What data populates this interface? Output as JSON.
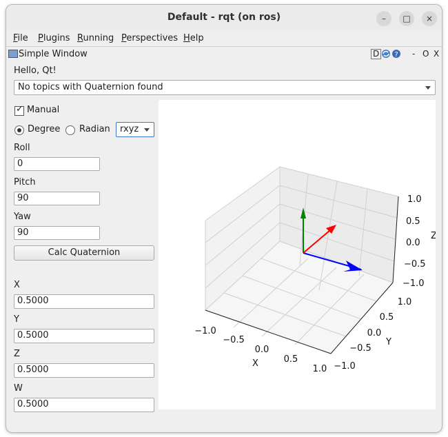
{
  "window": {
    "title": "Default - rqt (on ros)",
    "minimize": "–",
    "maximize": "□",
    "close": "×"
  },
  "menu": [
    {
      "label": "File",
      "mnemonic": "F",
      "rest": "ile"
    },
    {
      "label": "Plugins",
      "mnemonic": "P",
      "rest": "lugins"
    },
    {
      "label": "Running",
      "mnemonic": "R",
      "rest": "unning"
    },
    {
      "label": "Perspectives",
      "mnemonic": "P",
      "rest": "erspectives"
    },
    {
      "label": "Help",
      "mnemonic": "H",
      "rest": "elp"
    }
  ],
  "dock": {
    "title": "Simple Window",
    "d": "D",
    "min": "-",
    "float": "O",
    "close": "X"
  },
  "plugin": {
    "greeting": "Hello, Qt!",
    "topic_combo": "No topics with Quaternion found",
    "manual_label": "Manual",
    "manual_checked": true,
    "degree_label": "Degree",
    "radian_label": "Radian",
    "unit_selected": "Degree",
    "axes_order": "rxyz",
    "roll_label": "Roll",
    "roll_value": "0",
    "pitch_label": "Pitch",
    "pitch_value": "90",
    "yaw_label": "Yaw",
    "yaw_value": "90",
    "calc_button": "Calc Quaternion",
    "x_label": "X",
    "x_value": "0.5000",
    "y_label": "Y",
    "y_value": "0.5000",
    "z_label": "Z",
    "z_value": "0.5000",
    "w_label": "W",
    "w_value": "0.5000"
  },
  "plot": {
    "x_label": "X",
    "y_label": "Y",
    "z_label": "Z",
    "x_ticks": [
      "−1.0",
      "−0.5",
      "0.0",
      "0.5",
      "1.0"
    ],
    "y_ticks": [
      "1.0",
      "0.5",
      "0.0",
      "−0.5",
      "−1.0"
    ],
    "z_ticks": [
      "1.0",
      "0.5",
      "0.0",
      "−0.5",
      "−1.0"
    ],
    "colors": {
      "x_axis_arrow": "#0000ff",
      "y_axis_arrow": "#008000",
      "z_axis_arrow": "#ff0000"
    }
  }
}
